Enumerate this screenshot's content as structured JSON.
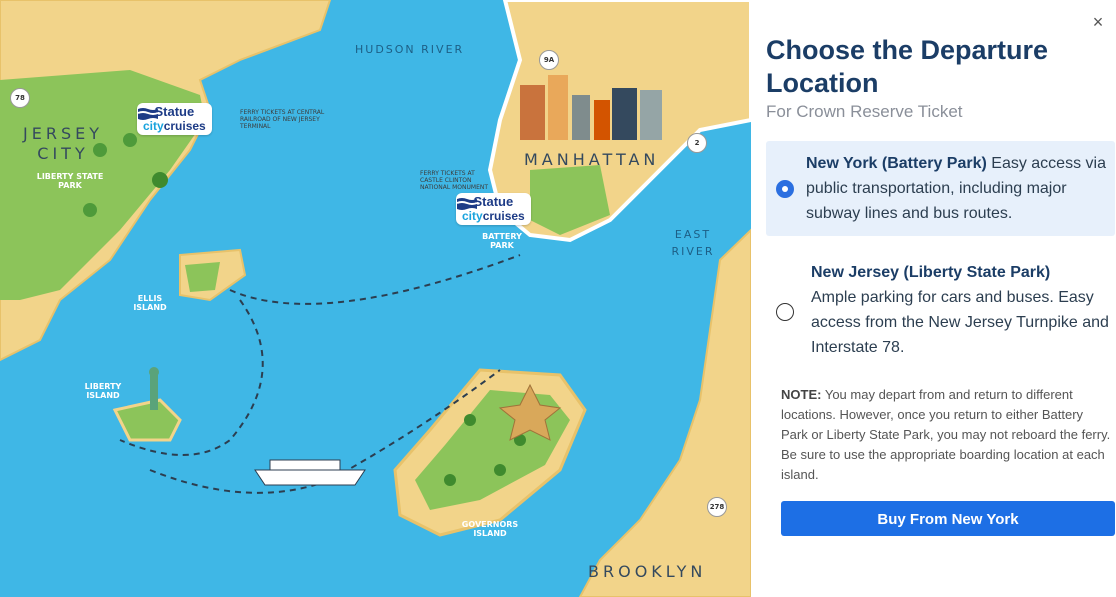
{
  "map": {
    "labels": {
      "hudson_river": "HUDSON RIVER",
      "east_river": "EAST RIVER",
      "manhattan": "MANHATTAN",
      "jersey_city": "JERSEY CITY",
      "liberty_state_park": "LIBERTY STATE PARK",
      "ellis_island": "ELLIS ISLAND",
      "liberty_island": "LIBERTY ISLAND",
      "battery_park": "BATTERY PARK",
      "governors_island": "GOVERNORS ISLAND",
      "brooklyn": "BROOKLYN",
      "ferry_nj": "FERRY TICKETS AT CENTRAL RAILROAD OF NEW JERSEY TERMINAL",
      "ferry_ny": "FERRY TICKETS AT CASTLE CLINTON NATIONAL MONUMENT"
    },
    "logo": {
      "line1": "Statue",
      "city": "city",
      "cruises": "cruises"
    },
    "route_shields": [
      "78",
      "9A",
      "2",
      "278"
    ]
  },
  "panel": {
    "close_label": "×",
    "title": "Choose the Departure Location",
    "subtitle": "For Crown Reserve Ticket",
    "options": [
      {
        "name": "New York (Battery Park)",
        "description": "Easy access via public transportation, including major subway lines and bus routes.",
        "selected": true
      },
      {
        "name": "New Jersey (Liberty State Park)",
        "description": "Ample parking for cars and buses. Easy access from the New Jersey Turnpike and Interstate 78.",
        "selected": false
      }
    ],
    "note_label": "NOTE:",
    "note_text": "You may depart from and return to different locations. However, once you return to either Battery Park or Liberty State Park, you may not reboard the ferry. Be sure to use the appropriate boarding location at each island.",
    "buy_button": "Buy From New York"
  },
  "colors": {
    "water": "#3fb7e6",
    "land": "#f2d48a",
    "park": "#8cc45a",
    "accent": "#1d6fe5",
    "title": "#1b3d66"
  }
}
